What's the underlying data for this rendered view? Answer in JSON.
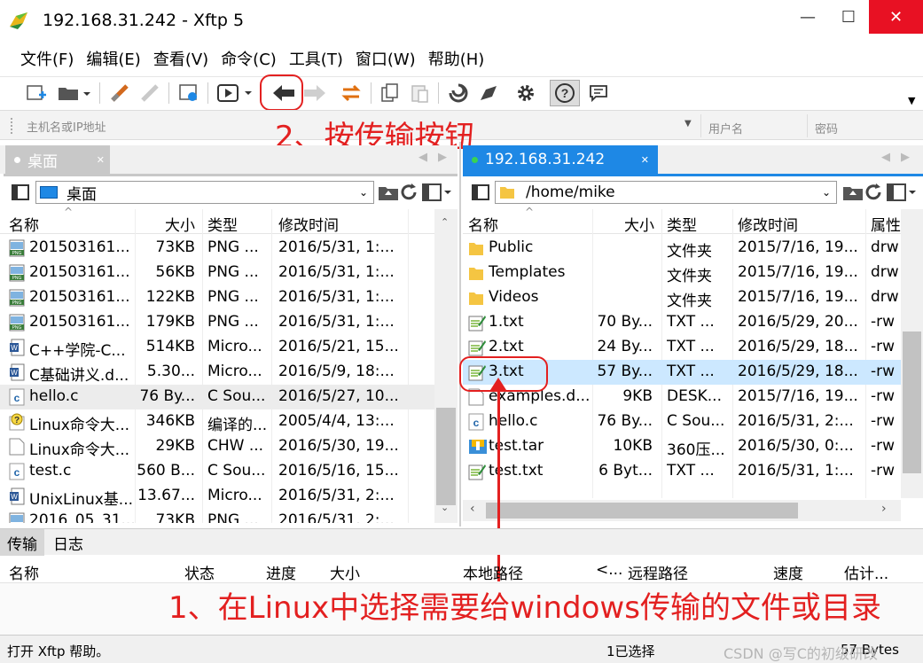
{
  "window": {
    "title": "192.168.31.242    - Xftp 5",
    "minimize": "—",
    "maximize": "☐",
    "close": "✕"
  },
  "menu": [
    "文件(F)",
    "编辑(E)",
    "查看(V)",
    "命令(C)",
    "工具(T)",
    "窗口(W)",
    "帮助(H)"
  ],
  "toolbar": {
    "icons": [
      "new-session-icon",
      "open-folder-icon",
      "connect-icon",
      "disconnect-icon",
      "properties-icon",
      "play-icon",
      "transfer-left-icon",
      "transfer-right-icon",
      "sync-icon",
      "copy-icon",
      "paste-icon",
      "xshell-icon",
      "xftp-icon",
      "settings-icon",
      "help-icon",
      "chat-icon"
    ]
  },
  "address": {
    "host_placeholder": "主机名或IP地址",
    "user_placeholder": "用户名",
    "pass_placeholder": "密码"
  },
  "annotations": {
    "step2": "2、按传输按钮",
    "step1": "1、在Linux中选择需要给windows传输的文件或目录"
  },
  "local": {
    "tab_label": "桌面",
    "path": "桌面",
    "columns": [
      "名称",
      "大小",
      "类型",
      "修改时间"
    ],
    "files": [
      {
        "name": "201503161...",
        "size": "73KB",
        "type": "PNG ...",
        "modified": "2016/5/31, 1:...",
        "icon": "png"
      },
      {
        "name": "201503161...",
        "size": "56KB",
        "type": "PNG ...",
        "modified": "2016/5/31, 1:...",
        "icon": "png"
      },
      {
        "name": "201503161...",
        "size": "122KB",
        "type": "PNG ...",
        "modified": "2016/5/31, 1:...",
        "icon": "png"
      },
      {
        "name": "201503161...",
        "size": "179KB",
        "type": "PNG ...",
        "modified": "2016/5/31, 1:...",
        "icon": "png"
      },
      {
        "name": "C++学院-C...",
        "size": "514KB",
        "type": "Micro...",
        "modified": "2016/5/21, 15...",
        "icon": "doc"
      },
      {
        "name": "C基础讲义.d...",
        "size": "5.30...",
        "type": "Micro...",
        "modified": "2016/5/9, 18:...",
        "icon": "doc"
      },
      {
        "name": "hello.c",
        "size": "76 By...",
        "type": "C Sou...",
        "modified": "2016/5/27, 10...",
        "icon": "c"
      },
      {
        "name": "Linux命令大...",
        "size": "346KB",
        "type": "编译的...",
        "modified": "2005/4/4, 13:...",
        "icon": "chm"
      },
      {
        "name": "Linux命令大...",
        "size": "29KB",
        "type": "CHW ...",
        "modified": "2016/5/30, 19...",
        "icon": "file"
      },
      {
        "name": "test.c",
        "size": "560 B...",
        "type": "C Sou...",
        "modified": "2016/5/16, 15...",
        "icon": "c"
      },
      {
        "name": "UnixLinux基...",
        "size": "13.67...",
        "type": "Micro...",
        "modified": "2016/5/31, 2:...",
        "icon": "doc"
      },
      {
        "name": "2016_05_31...",
        "size": "73KB",
        "type": "PNG ...",
        "modified": "2016/5/31, 2:...",
        "icon": "png"
      }
    ]
  },
  "remote": {
    "tab_label": "192.168.31.242",
    "path": "/home/mike",
    "columns": [
      "名称",
      "大小",
      "类型",
      "修改时间",
      "属性"
    ],
    "files": [
      {
        "name": "Public",
        "size": "",
        "type": "文件夹",
        "modified": "2015/7/16, 19...",
        "attr": "drw",
        "icon": "folder"
      },
      {
        "name": "Templates",
        "size": "",
        "type": "文件夹",
        "modified": "2015/7/16, 19...",
        "attr": "drw",
        "icon": "folder"
      },
      {
        "name": "Videos",
        "size": "",
        "type": "文件夹",
        "modified": "2015/7/16, 19...",
        "attr": "drw",
        "icon": "folder"
      },
      {
        "name": "1.txt",
        "size": "70 By...",
        "type": "TXT ...",
        "modified": "2016/5/29, 20...",
        "attr": "-rw",
        "icon": "txt"
      },
      {
        "name": "2.txt",
        "size": "24 By...",
        "type": "TXT ...",
        "modified": "2016/5/29, 18...",
        "attr": "-rw",
        "icon": "txt"
      },
      {
        "name": "3.txt",
        "size": "57 By...",
        "type": "TXT ...",
        "modified": "2016/5/29, 18...",
        "attr": "-rw",
        "icon": "txt"
      },
      {
        "name": "examples.d...",
        "size": "9KB",
        "type": "DESK...",
        "modified": "2015/7/16, 19...",
        "attr": "-rw",
        "icon": "file"
      },
      {
        "name": "hello.c",
        "size": "76 By...",
        "type": "C Sou...",
        "modified": "2016/5/31, 2:...",
        "attr": "-rw",
        "icon": "c"
      },
      {
        "name": "test.tar",
        "size": "10KB",
        "type": "360压...",
        "modified": "2016/5/30, 0:...",
        "attr": "-rw",
        "icon": "tar"
      },
      {
        "name": "test.txt",
        "size": "6 Byt...",
        "type": "TXT ...",
        "modified": "2016/5/31, 1:...",
        "attr": "-rw",
        "icon": "txt"
      }
    ]
  },
  "transfer": {
    "tabs": [
      "传输",
      "日志"
    ],
    "columns": [
      "名称",
      "状态",
      "进度",
      "大小",
      "本地路径",
      "<...",
      "远程路径",
      "速度",
      "估计..."
    ]
  },
  "status": {
    "help": "打开 Xftp 帮助。",
    "selected": "1已选择",
    "size": "57 Bytes",
    "watermark": "CSDN @写C的初级研改"
  },
  "colors": {
    "accent_blue": "#1e88e5",
    "annotation_red": "#e32020",
    "selection": "#cce8ff"
  }
}
